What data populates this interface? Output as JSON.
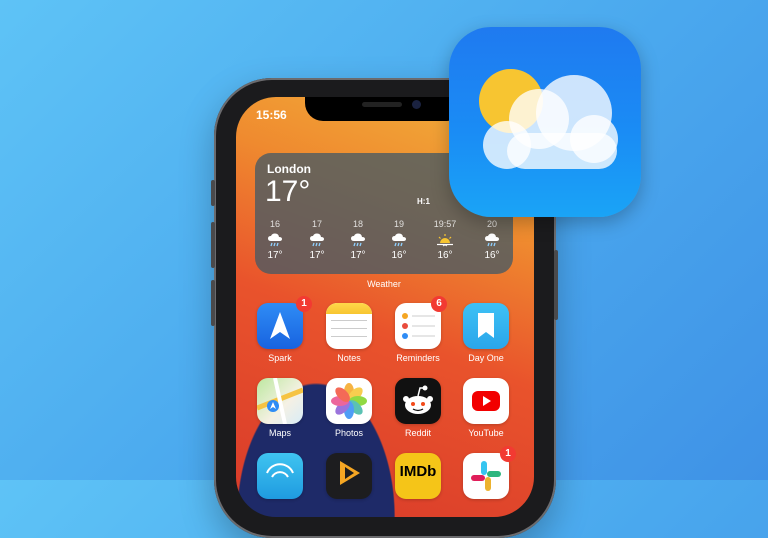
{
  "status_bar": {
    "time": "15:56"
  },
  "weather_widget": {
    "city": "London",
    "temperature": "17°",
    "high_low": "H:1",
    "hours": [
      {
        "label": "16",
        "icon": "cloud-rain-icon",
        "temp": "17°"
      },
      {
        "label": "17",
        "icon": "cloud-rain-icon",
        "temp": "17°"
      },
      {
        "label": "18",
        "icon": "cloud-rain-icon",
        "temp": "17°"
      },
      {
        "label": "19",
        "icon": "cloud-rain-icon",
        "temp": "16°"
      },
      {
        "label": "19:57",
        "icon": "sunset-icon",
        "temp": "16°"
      },
      {
        "label": "20",
        "icon": "cloud-rain-icon",
        "temp": "16°"
      }
    ],
    "title": "Weather"
  },
  "apps": [
    {
      "label": "Spark",
      "icon": "spark-icon",
      "badge": "1"
    },
    {
      "label": "Notes",
      "icon": "notes-icon"
    },
    {
      "label": "Reminders",
      "icon": "reminders-icon",
      "badge": "6"
    },
    {
      "label": "Day One",
      "icon": "day-one-icon"
    },
    {
      "label": "Maps",
      "icon": "maps-icon"
    },
    {
      "label": "Photos",
      "icon": "photos-icon"
    },
    {
      "label": "Reddit",
      "icon": "reddit-icon"
    },
    {
      "label": "YouTube",
      "icon": "youtube-icon"
    },
    {
      "label": "",
      "icon": "wifi-app-icon"
    },
    {
      "label": "",
      "icon": "infuse-icon"
    },
    {
      "label": "IMDb",
      "icon": "imdb-icon"
    },
    {
      "label": "",
      "icon": "slack-icon",
      "badge": "1"
    }
  ],
  "featured_icon": "weather-app-icon"
}
